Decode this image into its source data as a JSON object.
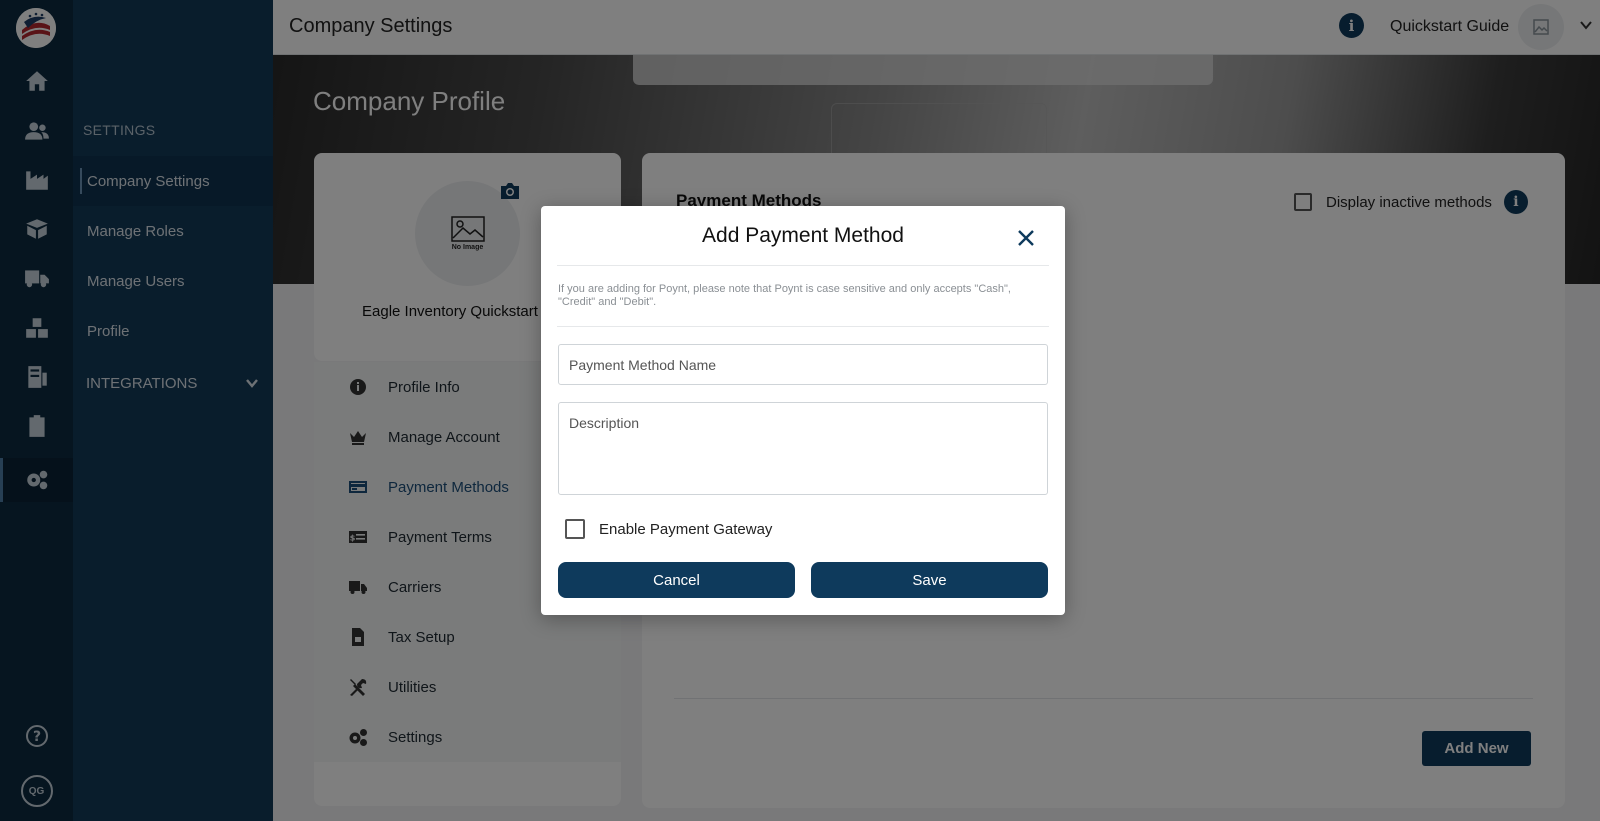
{
  "rail": {
    "icons": [
      "home-icon",
      "users-icon",
      "factory-icon",
      "box-icon",
      "truck-icon",
      "boxes-icon",
      "receipt-icon",
      "clipboard-icon",
      "gear-icon",
      "help-icon"
    ],
    "qg_label": "QG"
  },
  "sidebar": {
    "section_title": "SETTINGS",
    "items": [
      {
        "label": "Company Settings",
        "active": true
      },
      {
        "label": "Manage Roles"
      },
      {
        "label": "Manage Users"
      },
      {
        "label": "Profile"
      }
    ],
    "integrations_label": "INTEGRATIONS"
  },
  "topbar": {
    "title": "Company Settings",
    "quickstart": "Quickstart Guide"
  },
  "hero": {
    "title": "Company Profile"
  },
  "profile": {
    "no_image": "No Image",
    "company_name": "Eagle Inventory Quickstart G",
    "menu": [
      {
        "label": "Profile Info",
        "icon": "info-icon"
      },
      {
        "label": "Manage Account",
        "icon": "crown-icon"
      },
      {
        "label": "Payment Methods",
        "icon": "credit-card-icon",
        "active": true
      },
      {
        "label": "Payment Terms",
        "icon": "money-icon"
      },
      {
        "label": "Carriers",
        "icon": "truck-icon"
      },
      {
        "label": "Tax Setup",
        "icon": "file-invoice-icon"
      },
      {
        "label": "Utilities",
        "icon": "tools-icon"
      },
      {
        "label": "Settings",
        "icon": "gears-icon"
      }
    ]
  },
  "panel": {
    "title": "Payment Methods",
    "inactive_label": "Display inactive methods",
    "add_new": "Add New"
  },
  "modal": {
    "title": "Add Payment Method",
    "note": "If you are adding for Poynt, please note that Poynt is case sensitive and only accepts \"Cash\", \"Credit\" and \"Debit\".",
    "name_placeholder": "Payment Method Name",
    "description_placeholder": "Description",
    "gateway_label": "Enable Payment Gateway",
    "cancel": "Cancel",
    "save": "Save"
  },
  "colors": {
    "primary": "#0e3a5c",
    "rail": "#0d2a40",
    "sidebar": "#133a59"
  }
}
